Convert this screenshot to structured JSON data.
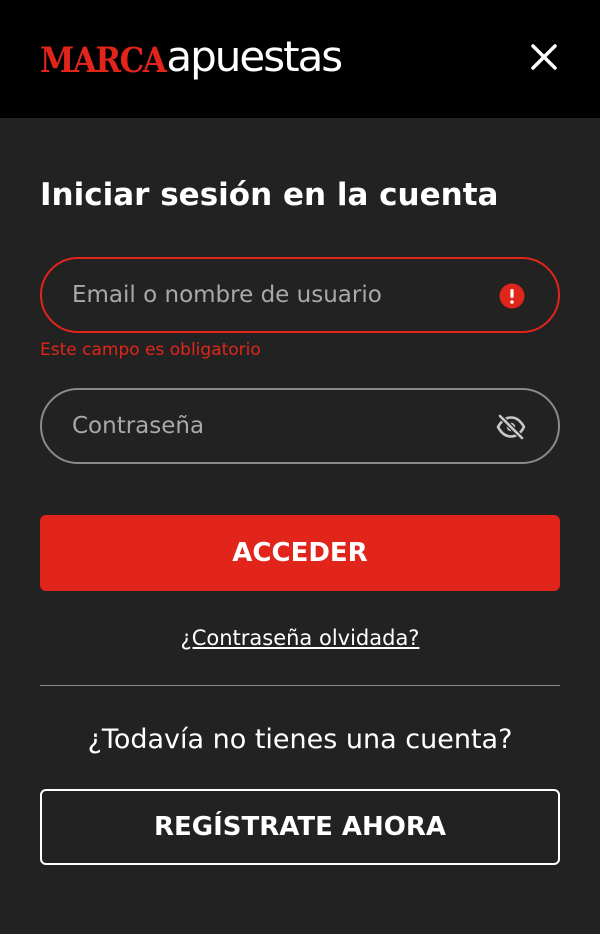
{
  "header": {
    "logo": {
      "part1": "MARCA",
      "part2": "apuestas"
    },
    "close_icon": "close-icon"
  },
  "login": {
    "title": "Iniciar sesión en la cuenta",
    "email": {
      "placeholder": "Email o nombre de usuario",
      "value": "",
      "error": "Este campo es obligatorio",
      "status_icon": "error-icon"
    },
    "password": {
      "placeholder": "Contraseña",
      "value": "",
      "toggle_icon": "eye-off-icon"
    },
    "submit_label": "ACCEDER",
    "forgot_link": "¿Contraseña olvidada?"
  },
  "signup": {
    "prompt": "¿Todavía no tienes una cuenta?",
    "button_label": "REGÍSTRATE AHORA"
  },
  "colors": {
    "accent": "#e1251b",
    "background": "#222222",
    "header": "#000000"
  }
}
